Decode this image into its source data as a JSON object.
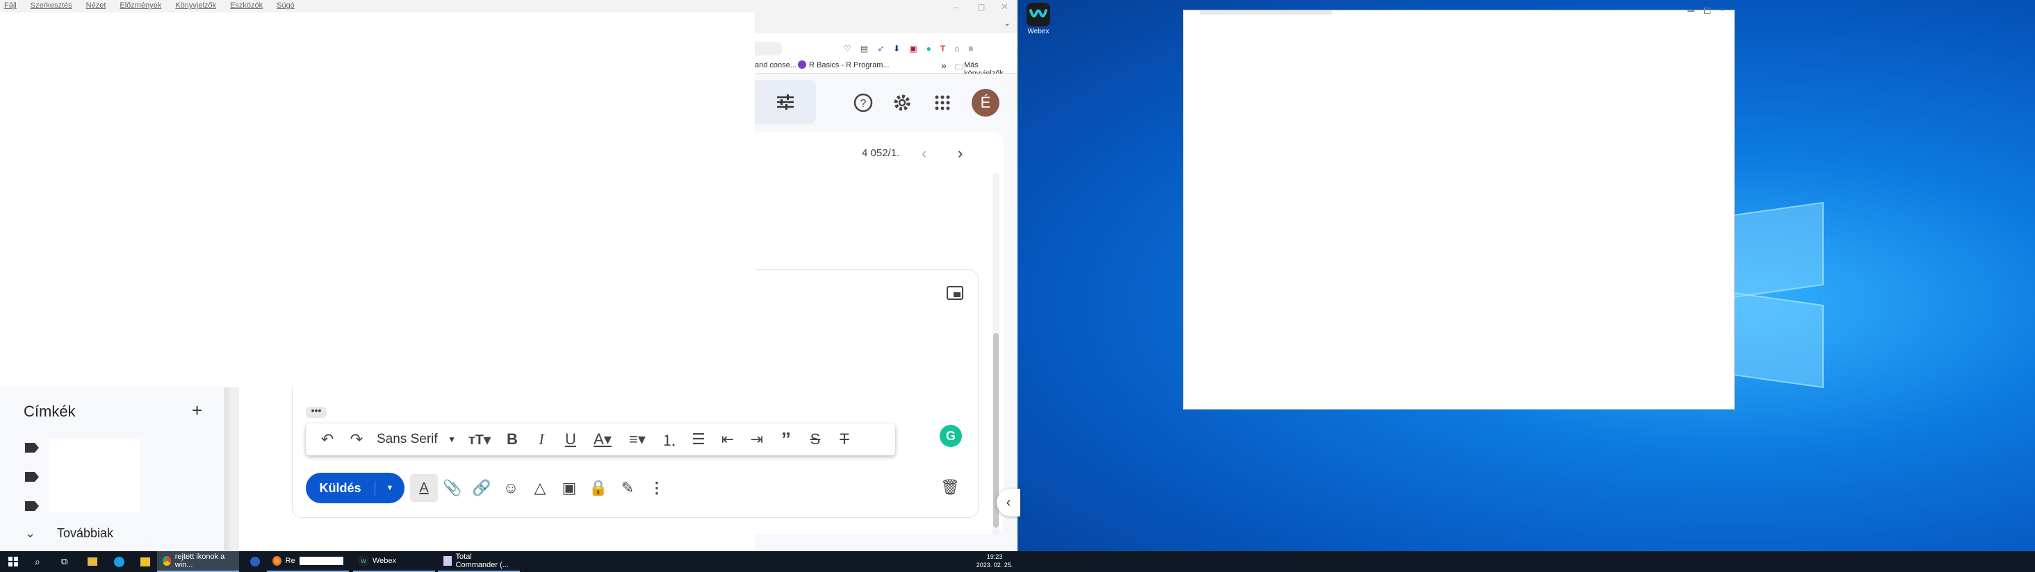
{
  "browser": {
    "menu": [
      "Fájl",
      "Szerkesztés",
      "Nézet",
      "Előzmények",
      "Könyvjelzők",
      "Eszközök",
      "Súgó"
    ],
    "bookmarks": {
      "item1": "and conse...",
      "item2": "R Basics - R Program...",
      "more": "»",
      "other": "Más könyvjelzők"
    }
  },
  "gmail": {
    "pagination": "4 052/1.",
    "avatar_letter": "É",
    "labels_title": "Címkék",
    "more_label": "Továbbiak",
    "font_name": "Sans Serif",
    "send_label": "Küldés",
    "grammarly_letter": "G"
  },
  "desktop": {
    "webex_icon_label": "Webex"
  },
  "taskbar": {
    "items": [
      {
        "label": "rejtett ikonok a win..."
      },
      {
        "label": "Re"
      },
      {
        "label": "Webex"
      },
      {
        "label": "Total Commander (..."
      }
    ],
    "time": "19:23",
    "date": "2023. 02. 25."
  },
  "colors": {
    "accent": "#0b57d0",
    "avatar": "#8d5a45",
    "taskbar": "#101923",
    "grammarly": "#15c39a"
  }
}
